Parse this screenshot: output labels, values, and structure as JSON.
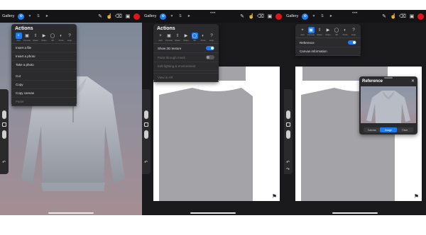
{
  "toolbar": {
    "gallery_label": "Gallery",
    "more_dots": "•••"
  },
  "actions_menu": {
    "title": "Actions",
    "tabs": [
      {
        "label": "Add",
        "icon": "plus-icon"
      },
      {
        "label": "Canvas",
        "icon": "canvas-icon"
      },
      {
        "label": "Share",
        "icon": "share-icon"
      },
      {
        "label": "Video",
        "icon": "video-icon"
      },
      {
        "label": "3D",
        "icon": "3d-icon"
      },
      {
        "label": "Prefs",
        "icon": "prefs-icon"
      },
      {
        "label": "Help",
        "icon": "help-icon"
      }
    ]
  },
  "panel1": {
    "active_tab": "Add",
    "items": [
      "Insert a file",
      "Insert a photo",
      "Take a photo"
    ],
    "items2": [
      "Cut",
      "Copy",
      "Copy canvas",
      "Paste"
    ]
  },
  "panel2": {
    "active_tab": "3D",
    "items": [
      {
        "label": "Show 2D texture",
        "toggle": "on"
      },
      {
        "label": "Paint through mesh",
        "toggle": "off"
      },
      {
        "label": "Edit lighting & environment"
      },
      {
        "label": "View in AR"
      }
    ]
  },
  "panel3": {
    "active_tab": "Canvas",
    "items": [
      {
        "label": "Reference",
        "toggle": "on"
      },
      {
        "label": "Canvas information"
      }
    ]
  },
  "reference_window": {
    "title": "Reference",
    "close": "✕",
    "segments": [
      "Canvas",
      "Image",
      "Face"
    ]
  },
  "colors": {
    "accent": "#1f7cf0",
    "color_swatch": "#e3151b",
    "shirt_gray": "#a4a3a8"
  }
}
